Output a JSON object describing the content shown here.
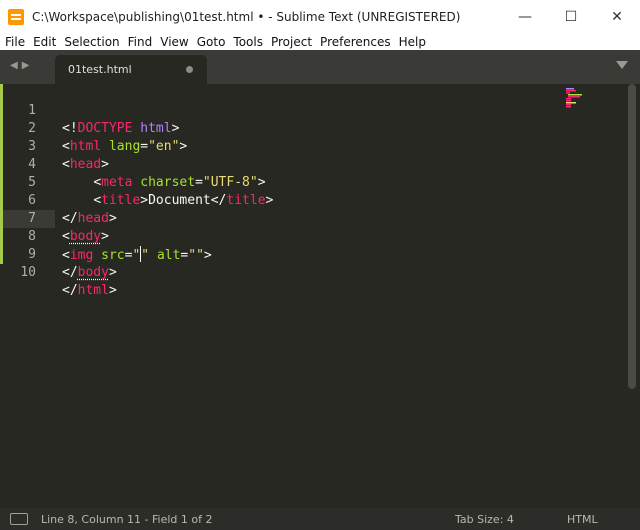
{
  "window": {
    "title": "C:\\Workspace\\publishing\\01test.html • - Sublime Text (UNREGISTERED)",
    "controls": [
      "—",
      "☐",
      "✕"
    ]
  },
  "menu": [
    "File",
    "Edit",
    "Selection",
    "Find",
    "View",
    "Goto",
    "Tools",
    "Project",
    "Preferences",
    "Help"
  ],
  "tab": {
    "label": "01test.html"
  },
  "code_lines": [
    {
      "n": "1"
    },
    {
      "n": "2"
    },
    {
      "n": "3"
    },
    {
      "n": "4"
    },
    {
      "n": "5"
    },
    {
      "n": "6"
    },
    {
      "n": "7"
    },
    {
      "n": "8"
    },
    {
      "n": "9"
    },
    {
      "n": "10"
    }
  ],
  "code": {
    "l1": {
      "open": "<!",
      "doctype": "DOCTYPE",
      "html": "html",
      "close": ">"
    },
    "l2": {
      "open": "<",
      "tag": "html",
      "attr": "lang",
      "eq": "=",
      "val": "\"en\"",
      "close": ">"
    },
    "l3": {
      "open": "<",
      "tag": "head",
      "close": ">"
    },
    "l4": {
      "indent": "    ",
      "open": "<",
      "tag": "meta",
      "attr": "charset",
      "eq": "=",
      "val": "\"UTF-8\"",
      "close": ">"
    },
    "l5": {
      "indent": "    ",
      "open": "<",
      "tag": "title",
      "close": ">",
      "text": "Document",
      "open2": "</",
      "tag2": "title",
      "close2": ">"
    },
    "l6": {
      "open": "</",
      "tag": "head",
      "close": ">"
    },
    "l7": {
      "open": "<",
      "tag": "body",
      "close": ">"
    },
    "l8": {
      "open": "<",
      "tag": "img",
      "attr1": "src",
      "eq1": "=",
      "val1a": "\"",
      "val1b": "\"",
      "attr2": "alt",
      "eq2": "=",
      "val2": "\"\"",
      "close": ">"
    },
    "l9": {
      "open": "</",
      "tag": "body",
      "close": ">"
    },
    "l10": {
      "open": "</",
      "tag": "html",
      "close": ">"
    }
  },
  "status": {
    "position": "Line 8, Column 11 - Field 1 of 2",
    "tab_size": "Tab Size: 4",
    "syntax": "HTML"
  },
  "colors": {
    "background": "#272822",
    "tag": "#f92672",
    "attribute": "#a6e22e",
    "string": "#e6db74",
    "doctype_keyword": "#ae81ff",
    "gutter_modified": "#a6c84b"
  }
}
